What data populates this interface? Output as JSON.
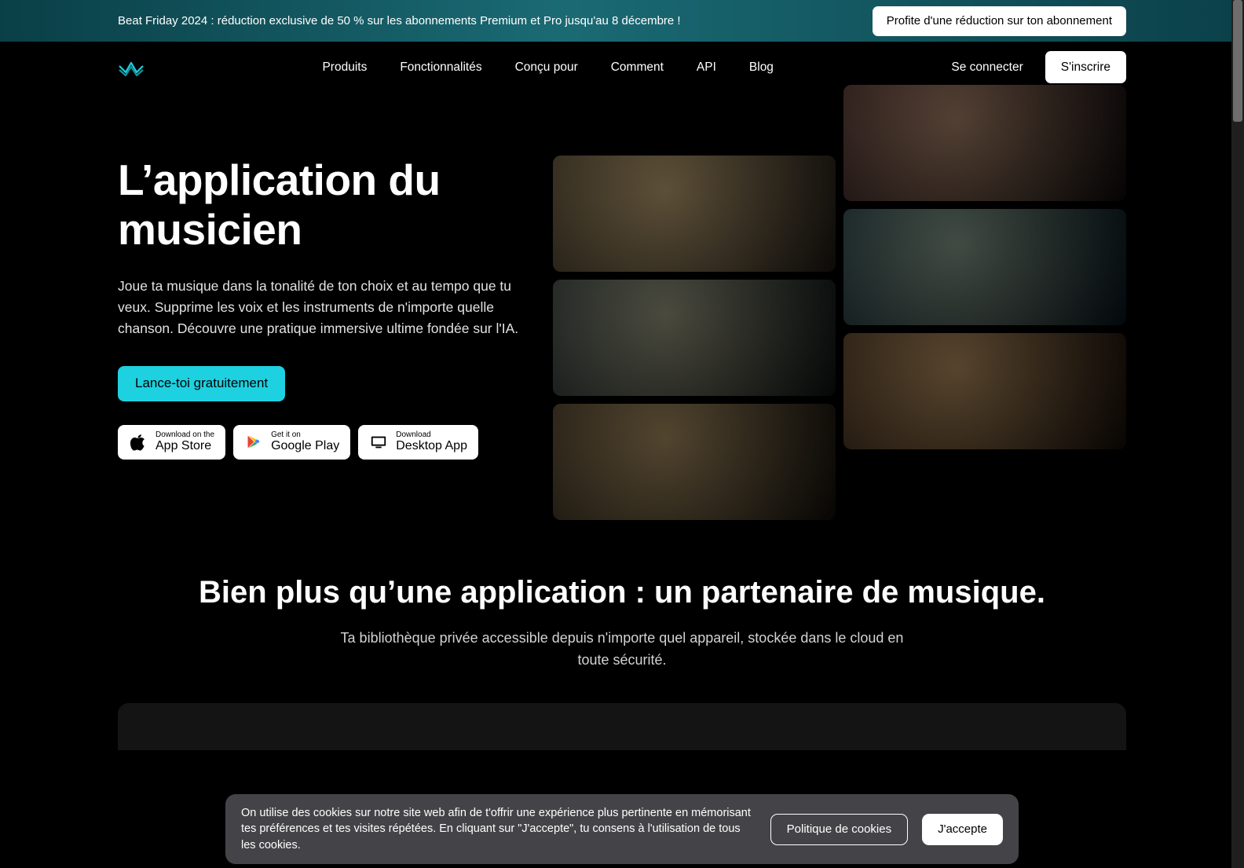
{
  "announce": {
    "text": "Beat Friday 2024 : réduction exclusive de 50 % sur les abonnements Premium et Pro jusqu'au 8 décembre !",
    "button": "Profite d'une réduction sur ton abonnement"
  },
  "nav": {
    "items": [
      "Produits",
      "Fonctionnalités",
      "Conçu pour",
      "Comment",
      "API",
      "Blog"
    ],
    "signin": "Se connecter",
    "signup": "S'inscrire"
  },
  "hero": {
    "title": "L’application du musicien",
    "desc": "Joue ta musique dans la tonalité de ton choix et au tempo que tu veux. Supprime les voix et les instruments de n'importe quelle chanson. Découvre une pratique immersive ultime fondée sur l'IA.",
    "cta": "Lance-toi gratuitement",
    "badges": [
      {
        "small": "Download on the",
        "big": "App Store"
      },
      {
        "small": "Get it on",
        "big": "Google Play"
      },
      {
        "small": "Download",
        "big": "Desktop App"
      }
    ]
  },
  "section2": {
    "title": "Bien plus qu’une application : un partenaire de musique.",
    "desc": "Ta bibliothèque privée accessible depuis n'importe quel appareil, stockée dans le cloud en toute sécurité."
  },
  "cookie": {
    "text": "On utilise des cookies sur notre site web afin de t'offrir une expérience plus pertinente en mémorisant tes préférences et tes visites répétées. En cliquant sur \"J'accepte\", tu consens à l'utilisation de tous les cookies.",
    "policy": "Politique de cookies",
    "accept": "J'accepte"
  }
}
